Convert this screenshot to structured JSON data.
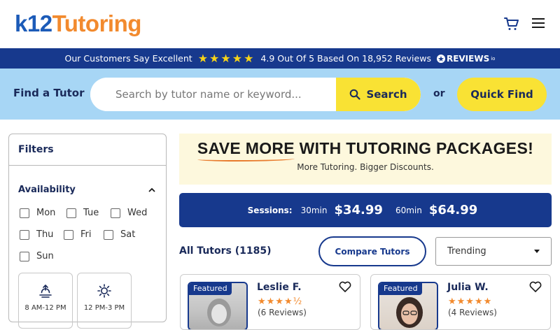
{
  "header": {
    "logo_k12": "k12",
    "logo_tutoring": "Tutoring"
  },
  "reviews_bar": {
    "text": "Our Customers Say Excellent",
    "stars": "★★★★★",
    "rating_text": "4.9 Out Of 5 Based On 18,952 Reviews",
    "brand": "REVIEWS",
    "brand_suffix": "io"
  },
  "search": {
    "label": "Find a Tutor",
    "placeholder": "Search by tutor name or keyword...",
    "button": "Search",
    "or": "or",
    "quick_find": "Quick Find"
  },
  "filters": {
    "title": "Filters",
    "availability": "Availability",
    "days": [
      "Mon",
      "Tue",
      "Wed",
      "Thu",
      "Fri",
      "Sat",
      "Sun"
    ],
    "times": [
      "8 AM-12 PM",
      "12 PM-3 PM"
    ]
  },
  "promo": {
    "title_a": "SAVE MORE",
    "title_b": " WITH TUTORING PACKAGES!",
    "subtitle": "More Tutoring. Bigger Discounts."
  },
  "sessions": {
    "label": "Sessions:",
    "dur1": "30min",
    "price1": "$34.99",
    "dur2": "60min",
    "price2": "$64.99"
  },
  "tutors_bar": {
    "count_label": "All Tutors (1185)",
    "compare": "Compare Tutors",
    "sort": "Trending"
  },
  "tutors": [
    {
      "badge": "Featured",
      "name": "Leslie F.",
      "stars": "★★★★½",
      "reviews": "(6 Reviews)"
    },
    {
      "badge": "Featured",
      "name": "Julia W.",
      "stars": "★★★★★",
      "reviews": "(4 Reviews)"
    }
  ],
  "colors": {
    "navy": "#17398d",
    "yellow": "#f9e234",
    "light_blue": "#a7d6f5",
    "orange": "#f28a2e"
  }
}
